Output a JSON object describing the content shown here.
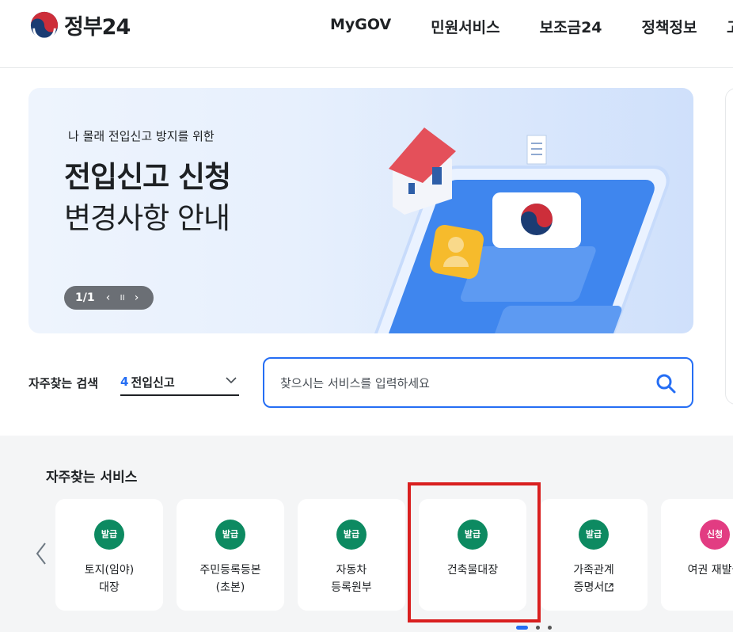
{
  "header": {
    "logo_text": "정부24",
    "nav": [
      "MyGOV",
      "민원서비스",
      "보조금24",
      "정책정보"
    ],
    "nav_cut": "고"
  },
  "banner": {
    "subtitle": "나 몰래 전입신고 방지를 위한",
    "title_line1": "전입신고 신청",
    "title_line2": "변경사항 안내",
    "pager": {
      "text": "1/1",
      "prev": "‹",
      "pause": "II",
      "next": "›"
    }
  },
  "search": {
    "freq_label": "자주찾는 검색",
    "freq_selected_num": "4",
    "freq_selected_word": "전입신고",
    "placeholder": "찾으시는 서비스를 입력하세요",
    "value": ""
  },
  "services": {
    "title": "자주찾는 서비스",
    "cards": [
      {
        "badge": "발급",
        "line1": "토지(임야)",
        "line2": "대장"
      },
      {
        "badge": "발급",
        "line1": "주민등록등본",
        "line2": "(초본)"
      },
      {
        "badge": "발급",
        "line1": "자동차",
        "line2": "등록원부"
      },
      {
        "badge": "발급",
        "line1": "건축물대장",
        "line2": ""
      },
      {
        "badge": "발급",
        "line1": "가족관계",
        "line2": "증명서"
      },
      {
        "badge": "신청",
        "line1": "여권 재발급",
        "line2": ""
      }
    ]
  },
  "colors": {
    "accent": "#256ef4",
    "badge_green": "#0d8a61",
    "badge_pink": "#e23c82",
    "highlight": "#d91f1f"
  }
}
